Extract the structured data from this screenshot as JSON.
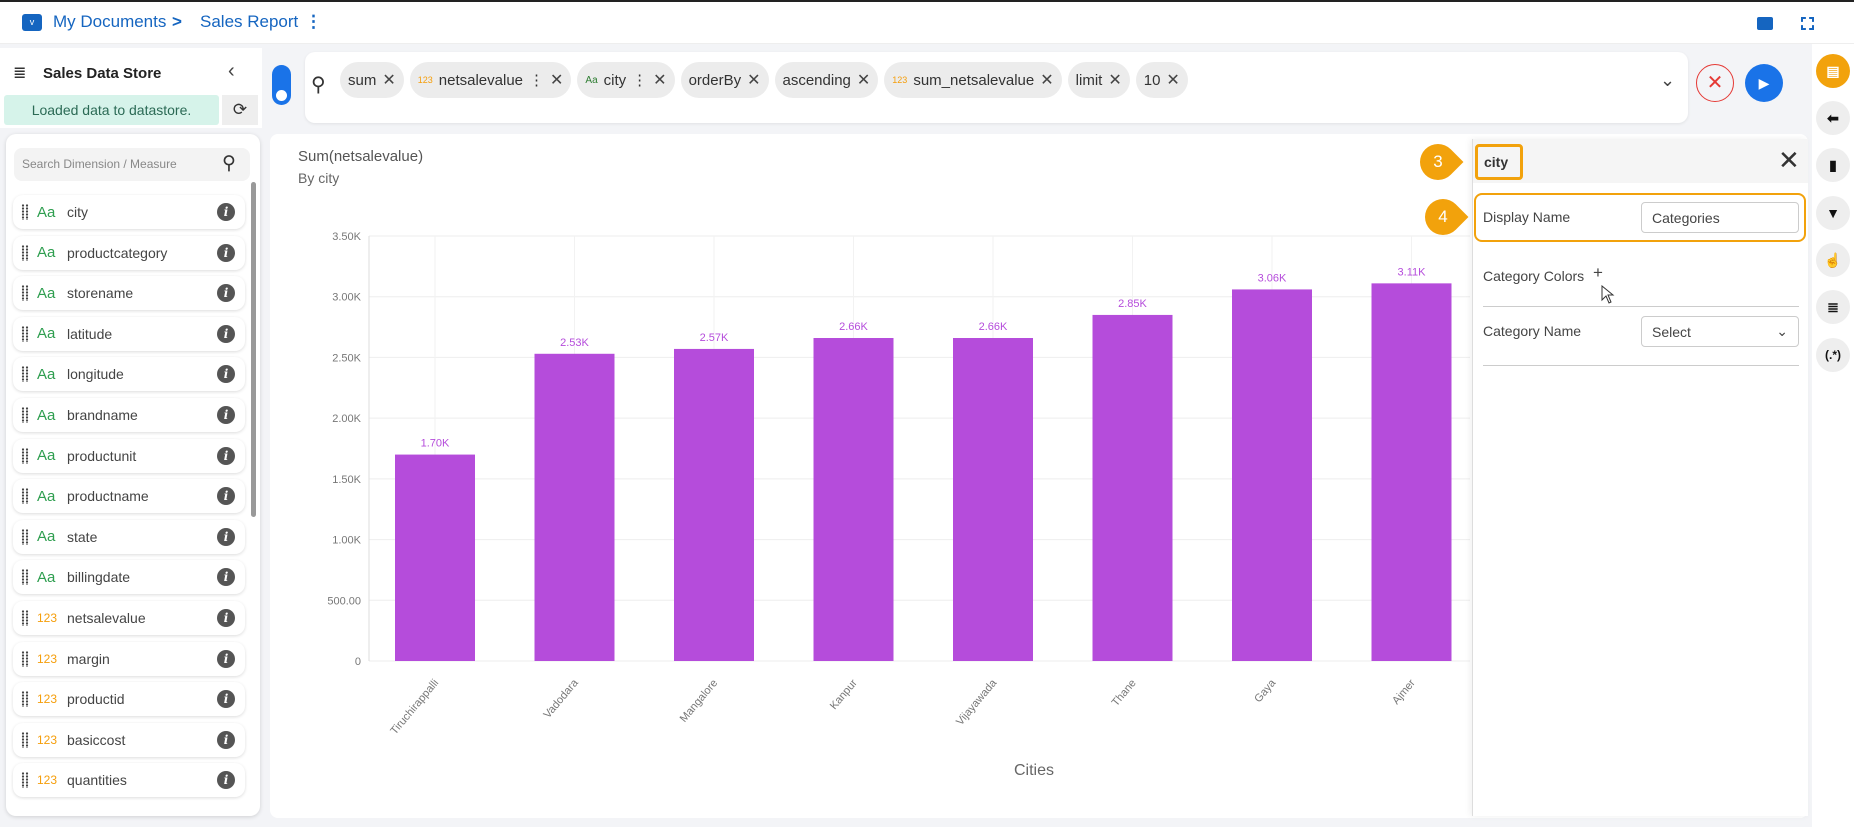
{
  "header": {
    "folder_icon": "folder-icon",
    "my_documents": "My Documents",
    "separator": ">",
    "report": "Sales Report"
  },
  "datastore": {
    "title": "Sales Data Store",
    "status": "Loaded data to datastore."
  },
  "query": {
    "tokens": [
      {
        "label": "sum",
        "type": ""
      },
      {
        "label": "netsalevalue",
        "type": "123",
        "menu": true
      },
      {
        "label": "city",
        "type": "Aa",
        "menu": true
      },
      {
        "label": "orderBy",
        "type": ""
      },
      {
        "label": "ascending",
        "type": ""
      },
      {
        "label": "sum_netsalevalue",
        "type": "123"
      },
      {
        "label": "limit",
        "type": ""
      },
      {
        "label": "10",
        "type": ""
      }
    ]
  },
  "sidebar": {
    "search_placeholder": "Search Dimension / Measure",
    "items": [
      {
        "type": "Aa",
        "label": "city"
      },
      {
        "type": "Aa",
        "label": "productcategory"
      },
      {
        "type": "Aa",
        "label": "storename"
      },
      {
        "type": "Aa",
        "label": "latitude"
      },
      {
        "type": "Aa",
        "label": "longitude"
      },
      {
        "type": "Aa",
        "label": "brandname"
      },
      {
        "type": "Aa",
        "label": "productunit"
      },
      {
        "type": "Aa",
        "label": "productname"
      },
      {
        "type": "Aa",
        "label": "state"
      },
      {
        "type": "Aa",
        "label": "billingdate"
      },
      {
        "type": "123",
        "label": "netsalevalue"
      },
      {
        "type": "123",
        "label": "margin"
      },
      {
        "type": "123",
        "label": "productid"
      },
      {
        "type": "123",
        "label": "basiccost"
      },
      {
        "type": "123",
        "label": "quantities"
      }
    ]
  },
  "chart_data": {
    "type": "bar",
    "title": "Sum(netsalevalue)",
    "subtitle": "By city",
    "xlabel": "Cities",
    "ylabel": "",
    "categories": [
      "Tiruchirappalli",
      "Vadodara",
      "Mangalore",
      "Kanpur",
      "Vijayawada",
      "Thane",
      "Gaya",
      "Ajmer"
    ],
    "values": [
      1700,
      2530,
      2570,
      2660,
      2660,
      2850,
      3060,
      3110
    ],
    "data_labels": [
      "1.70K",
      "2.53K",
      "2.57K",
      "2.66K",
      "2.66K",
      "2.85K",
      "3.06K",
      "3.11K"
    ],
    "ylim": [
      0,
      3500
    ],
    "yticks": [
      0,
      500,
      1000,
      1500,
      2000,
      2500,
      3000,
      3500
    ],
    "ytick_labels": [
      "0",
      "500.00",
      "1.00K",
      "1.50K",
      "2.00K",
      "2.50K",
      "3.00K",
      "3.50K"
    ],
    "color": "#b54cdb",
    "grid": true
  },
  "properties": {
    "title": "city",
    "display_name_label": "Display Name",
    "display_name_value": "Categories",
    "category_colors_label": "Category Colors",
    "add": "+",
    "category_name_label": "Category Name",
    "category_name_value": "Select"
  },
  "annotations": {
    "step3": "3",
    "step4": "4"
  },
  "colors": {
    "accent": "#1565c0",
    "highlight": "#f2a20c",
    "bar": "#b54cdb"
  }
}
